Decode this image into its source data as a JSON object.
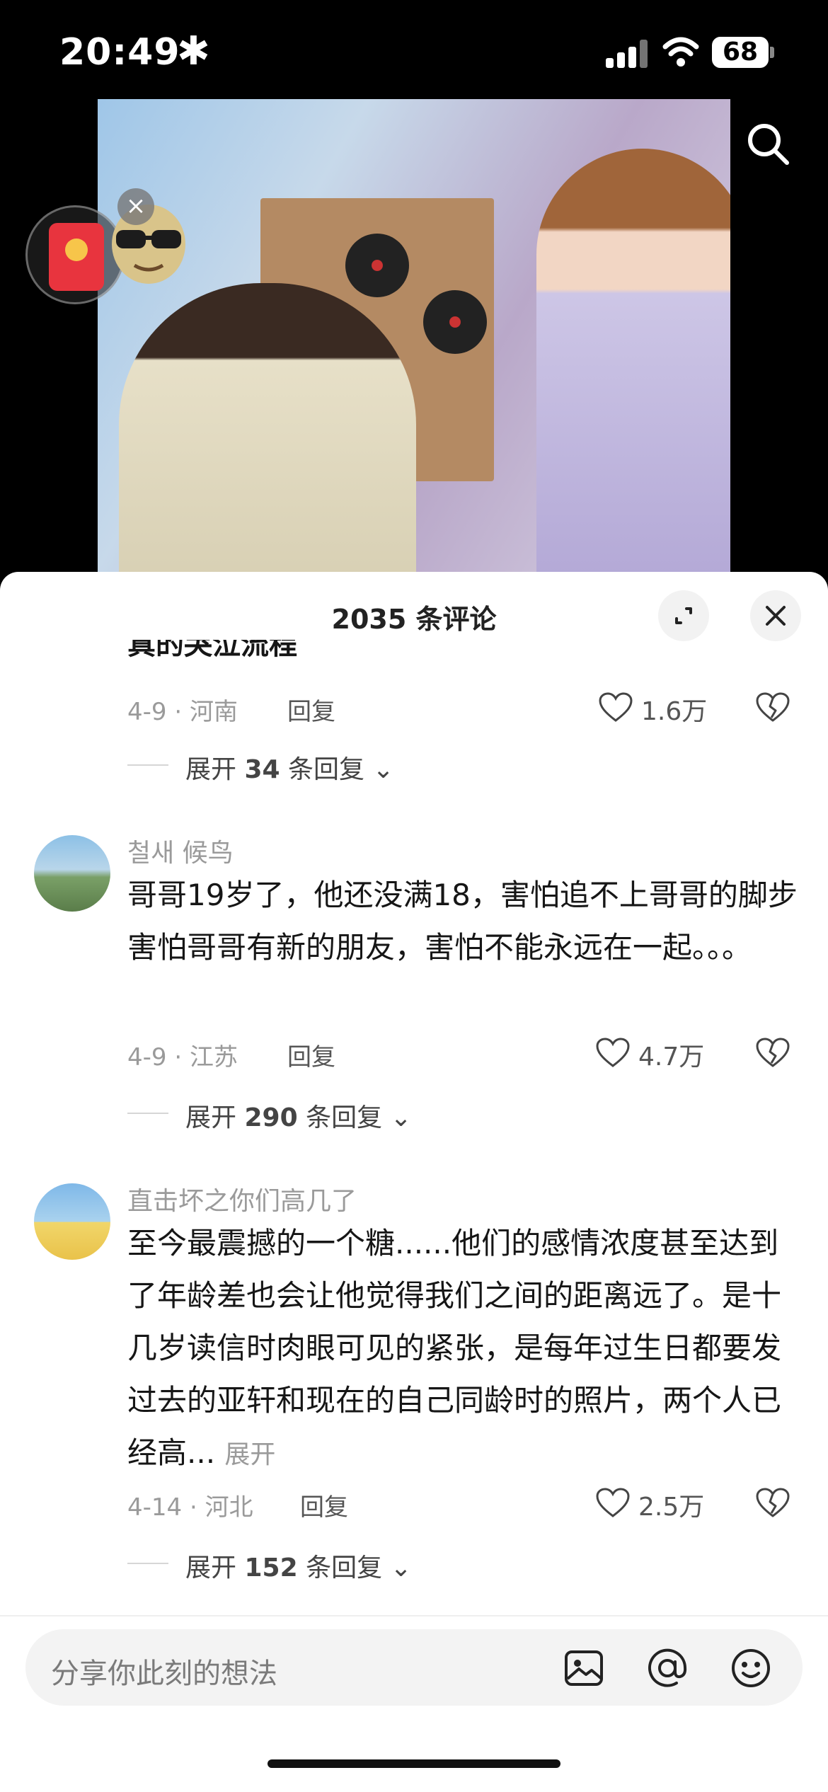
{
  "status_bar": {
    "time": "20:49",
    "indicator": "✱",
    "battery": "68"
  },
  "video": {
    "description_icons": [
      "search-icon",
      "red-packet-icon",
      "sunglasses-sticker-icon",
      "close-icon"
    ],
    "close_glyph": "×"
  },
  "comments_panel": {
    "title": "2035 条评论",
    "truncated_prev_text": "真的哭泣流程",
    "prev_comment": {
      "meta": "4-9 · 河南",
      "reply_label": "回复",
      "likes": "1.6万",
      "expand_prefix": "展开",
      "expand_count": "34",
      "expand_suffix": "条回复"
    },
    "comments": [
      {
        "username": "철새 候鸟",
        "text": "哥哥19岁了，他还没满18，害怕追不上哥哥的脚步 害怕哥哥有新的朋友，害怕不能永远在一起。。。",
        "meta": "4-9 · 江苏",
        "reply_label": "回复",
        "likes": "4.7万",
        "expand_prefix": "展开",
        "expand_count": "290",
        "expand_suffix": "条回复"
      },
      {
        "username": "直击坏之你们高几了",
        "text": "至今最震撼的一个糖......他们的感情浓度甚至达到了年龄差也会让他觉得我们之间的距离远了。是十几岁读信时肉眼可见的紧张，是每年过生日都要发过去的亚轩和现在的自己同龄时的照片，两个人已经高...",
        "more_label": "展开",
        "meta": "4-14 · 河北",
        "reply_label": "回复",
        "likes": "2.5万",
        "expand_prefix": "展开",
        "expand_count": "152",
        "expand_suffix": "条回复"
      }
    ],
    "composer": {
      "placeholder": "分享你此刻的想法"
    }
  },
  "colors": {
    "accent_red": "#e8343e",
    "text_primary": "#161616",
    "text_muted": "#9a9a9a"
  }
}
